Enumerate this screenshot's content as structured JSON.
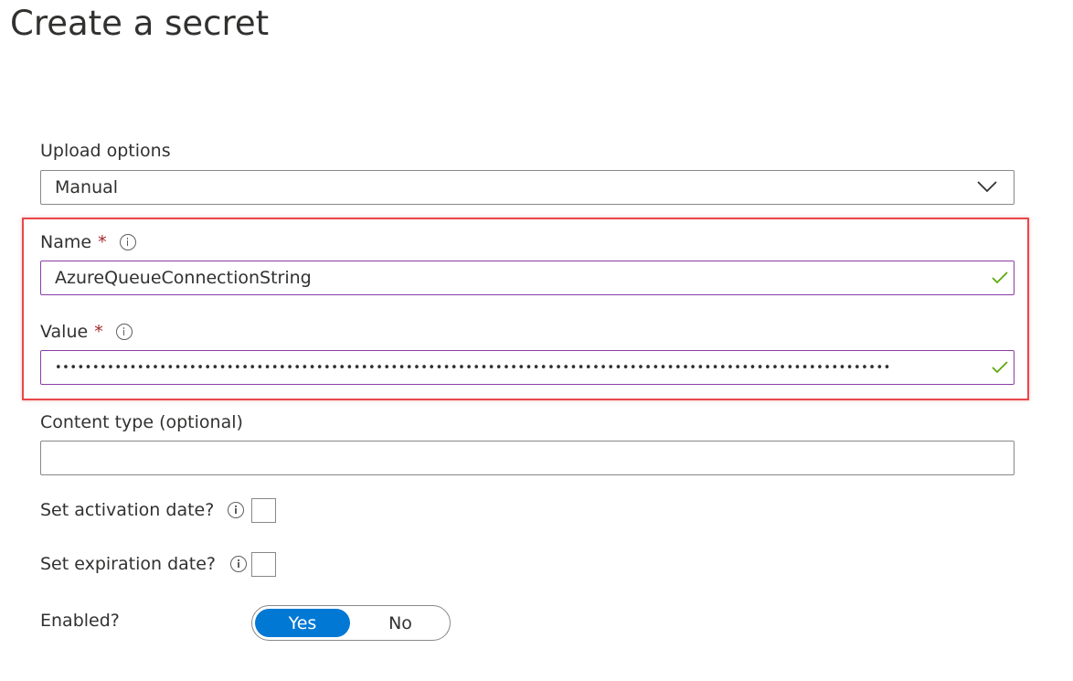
{
  "page": {
    "title": "Create a secret"
  },
  "upload_options": {
    "label": "Upload options",
    "selected": "Manual"
  },
  "name_field": {
    "label": "Name",
    "required_marker": "*",
    "value": "AzureQueueConnectionString"
  },
  "value_field": {
    "label": "Value",
    "required_marker": "*",
    "masked_value": "••••••••••••••••••••••••••••••••••••••••••••••••••••••••••••••••••••••••••••••••••••••••••••••••••••••••••••••••"
  },
  "content_type": {
    "label": "Content type (optional)",
    "value": ""
  },
  "activation_date": {
    "label": "Set activation date?"
  },
  "expiration_date": {
    "label": "Set expiration date?"
  },
  "enabled": {
    "label": "Enabled?",
    "options": [
      "Yes",
      "No"
    ],
    "selected": "Yes"
  },
  "icons": {
    "info": "info-icon",
    "chevron": "chevron-down-icon",
    "valid": "checkmark-icon"
  },
  "colors": {
    "accent": "#0078d4",
    "focus_border": "#8a3ea7",
    "valid_check": "#57a300",
    "required_star": "#a4262c",
    "highlight": "#e8474b"
  }
}
